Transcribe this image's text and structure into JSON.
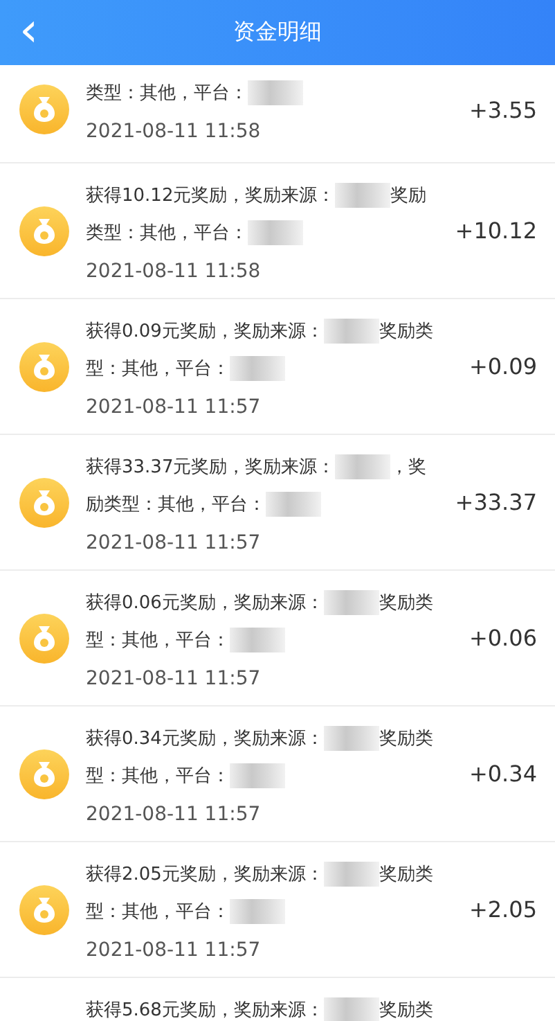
{
  "header": {
    "back_icon": "‹",
    "title": "资金明细"
  },
  "records": [
    {
      "kind": "partial_top",
      "segments": [
        {
          "kind": "text",
          "text": "类型：其他，平台："
        },
        {
          "kind": "blur"
        }
      ],
      "amount": "+3.55",
      "time": "2021-08-11 11:58"
    },
    {
      "kind": "full",
      "segments": [
        {
          "kind": "text",
          "text": "获得10.12元奖励，奖励来源："
        },
        {
          "kind": "blur"
        },
        {
          "kind": "text",
          "text": "奖励类型：其他，平台："
        },
        {
          "kind": "blur"
        }
      ],
      "amount": "+10.12",
      "time": "2021-08-11 11:58"
    },
    {
      "kind": "full",
      "segments": [
        {
          "kind": "text",
          "text": "获得0.09元奖励，奖励来源："
        },
        {
          "kind": "blur"
        },
        {
          "kind": "text",
          "text": "奖励类型：其他，平台："
        },
        {
          "kind": "blur"
        }
      ],
      "amount": "+0.09",
      "time": "2021-08-11 11:57"
    },
    {
      "kind": "full",
      "segments": [
        {
          "kind": "text",
          "text": "获得33.37元奖励，奖励来源："
        },
        {
          "kind": "blur"
        },
        {
          "kind": "text",
          "text": "，奖励类型：其他，平台："
        },
        {
          "kind": "blur"
        }
      ],
      "amount": "+33.37",
      "time": "2021-08-11 11:57"
    },
    {
      "kind": "full",
      "segments": [
        {
          "kind": "text",
          "text": "获得0.06元奖励，奖励来源："
        },
        {
          "kind": "blur"
        },
        {
          "kind": "text",
          "text": "奖励类型：其他，平台："
        },
        {
          "kind": "blur"
        }
      ],
      "amount": "+0.06",
      "time": "2021-08-11 11:57"
    },
    {
      "kind": "full",
      "segments": [
        {
          "kind": "text",
          "text": "获得0.34元奖励，奖励来源："
        },
        {
          "kind": "blur"
        },
        {
          "kind": "text",
          "text": "奖励类型：其他，平台："
        },
        {
          "kind": "blur"
        }
      ],
      "amount": "+0.34",
      "time": "2021-08-11 11:57"
    },
    {
      "kind": "full",
      "segments": [
        {
          "kind": "text",
          "text": "获得2.05元奖励，奖励来源："
        },
        {
          "kind": "blur"
        },
        {
          "kind": "text",
          "text": "奖励类型：其他，平台："
        },
        {
          "kind": "blur"
        }
      ],
      "amount": "+2.05",
      "time": "2021-08-11 11:57"
    },
    {
      "kind": "partial_bottom",
      "segments": [
        {
          "kind": "text",
          "text": "获得5.68元奖励，奖励来源："
        },
        {
          "kind": "blur"
        },
        {
          "kind": "text",
          "text": "奖励类"
        }
      ]
    }
  ]
}
